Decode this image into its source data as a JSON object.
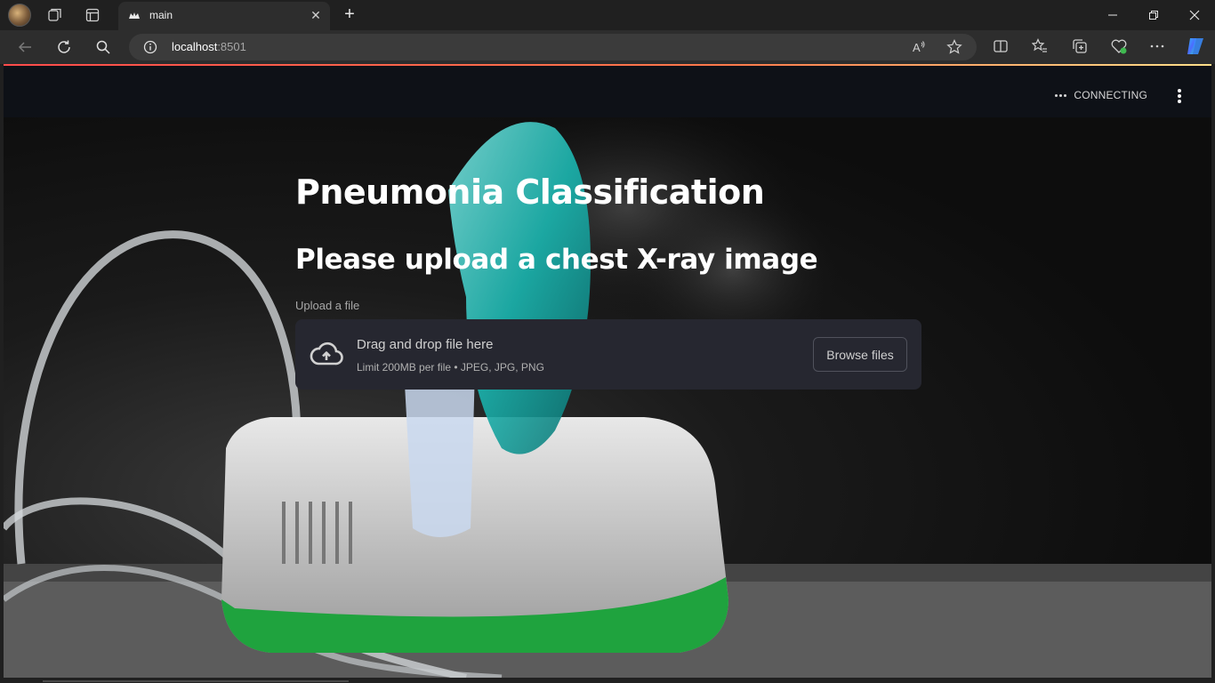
{
  "browser": {
    "tab_title": "main",
    "url_host": "localhost",
    "url_port": ":8501",
    "icons": {
      "profile": "profile-avatar",
      "workspaces": "workspaces-icon",
      "tab_actions": "tab-actions-icon",
      "back": "back-arrow-icon",
      "refresh": "refresh-icon",
      "search": "search-icon",
      "info": "info-icon",
      "read_aloud": "read-aloud-icon",
      "favorite": "star-icon",
      "split": "split-screen-icon",
      "favorites": "favorites-icon",
      "collections": "collections-icon",
      "health": "browser-essentials-icon",
      "more": "more-icon",
      "copilot": "copilot-icon"
    }
  },
  "app": {
    "status": "CONNECTING",
    "title": "Pneumonia Classification",
    "subtitle": "Please upload a chest X-ray image",
    "uploader": {
      "label": "Upload a file",
      "drop_text": "Drag and drop file here",
      "limit_text": "Limit 200MB per file • JPEG, JPG, PNG",
      "browse_label": "Browse files"
    }
  },
  "colors": {
    "app_header": "#0e1117",
    "dropzone": "#262730",
    "accent": "#ff4b4b"
  }
}
